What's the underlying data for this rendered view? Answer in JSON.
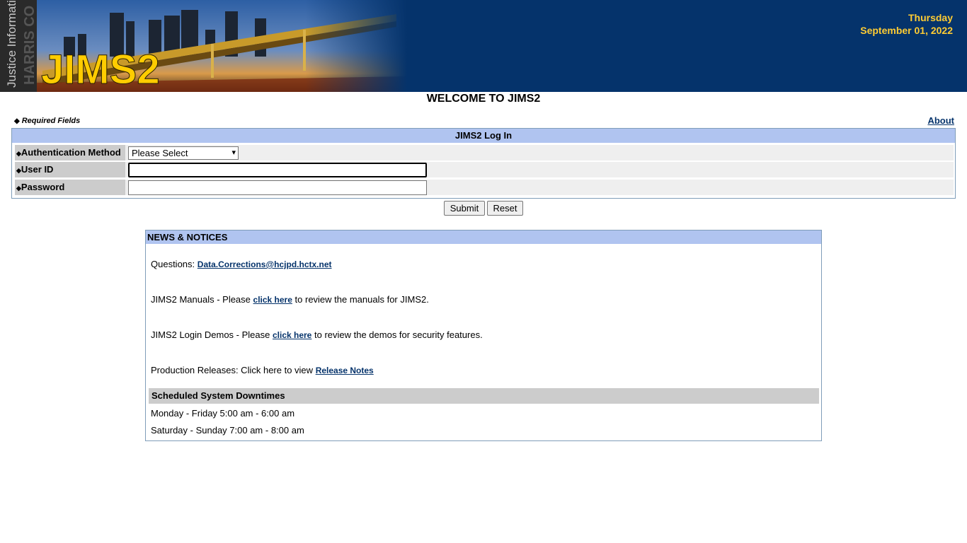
{
  "header": {
    "logo_text": "JIMS2",
    "logo_subtext": "Justice Information",
    "logo_side_text": "HARRIS CO",
    "day": "Thursday",
    "date": "September 01, 2022"
  },
  "welcome": "WELCOME TO JIMS2",
  "required_note": {
    "marker": "◆",
    "label": "Required Fields"
  },
  "about_link": "About",
  "login": {
    "title": "JIMS2 Log In",
    "fields": [
      {
        "label": "Authentication Method",
        "type": "select",
        "value": "Please Select"
      },
      {
        "label": "User ID",
        "type": "text",
        "value": ""
      },
      {
        "label": "Password",
        "type": "password",
        "value": ""
      }
    ],
    "submit_label": "Submit",
    "reset_label": "Reset"
  },
  "news": {
    "title": "NEWS & NOTICES",
    "questions_prefix": "Questions:",
    "questions_email": "Data.Corrections@hcjpd.hctx.net",
    "manuals_prefix": "JIMS2 Manuals - Please",
    "manuals_link": "click here",
    "manuals_suffix": "to review the manuals for JIMS2.",
    "demos_prefix": "JIMS2 Login Demos - Please",
    "demos_link": "click here",
    "demos_suffix": "to review the demos for security features.",
    "releases_prefix": "Production Releases: Click here to view",
    "releases_link": "Release Notes",
    "downtimes_title": "Scheduled System Downtimes",
    "downtimes": [
      "Monday - Friday 5:00 am - 6:00 am",
      "Saturday - Sunday 7:00 am - 8:00 am"
    ]
  },
  "colors": {
    "banner": "#05336b",
    "date_text": "#ffcc33",
    "panel_header": "#b0c4f0",
    "label_bg": "#cccccc"
  }
}
